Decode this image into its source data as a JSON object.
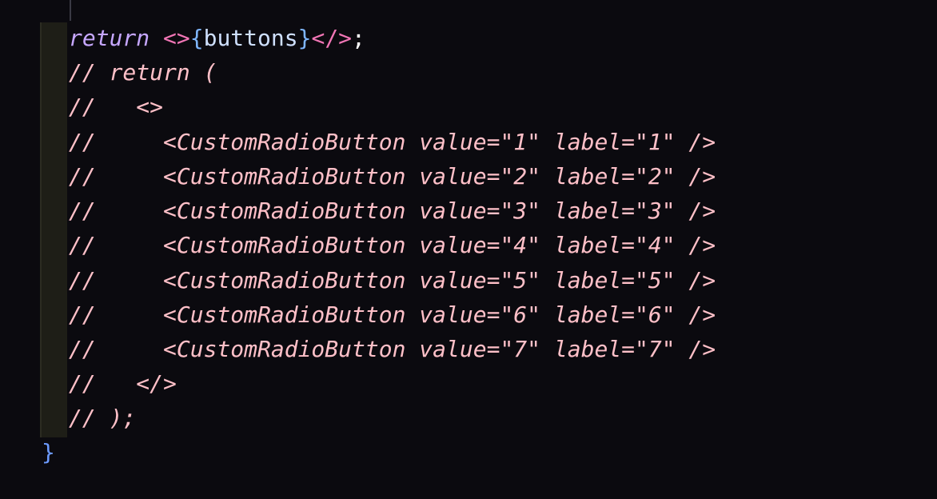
{
  "code": {
    "line1": {
      "keyword": "return",
      "open_fragment": "<>",
      "open_brace": "{",
      "ident": "buttons",
      "close_brace": "}",
      "close_fragment": "</>",
      "semicolon": ";"
    },
    "comment_lines": [
      "// return (",
      "//   <>",
      "//     <CustomRadioButton value=\"1\" label=\"1\" />",
      "//     <CustomRadioButton value=\"2\" label=\"2\" />",
      "//     <CustomRadioButton value=\"3\" label=\"3\" />",
      "//     <CustomRadioButton value=\"4\" label=\"4\" />",
      "//     <CustomRadioButton value=\"5\" label=\"5\" />",
      "//     <CustomRadioButton value=\"6\" label=\"6\" />",
      "//     <CustomRadioButton value=\"7\" label=\"7\" />",
      "//   </>",
      "// );"
    ],
    "closing_brace": "}"
  },
  "colors": {
    "background": "#0b0a0f",
    "keyword": "#c6a7ff",
    "jsx_tag": "#f276b6",
    "brace": "#7fb6ff",
    "identifier": "#cfe0ff",
    "comment": "#ffc0c8"
  }
}
